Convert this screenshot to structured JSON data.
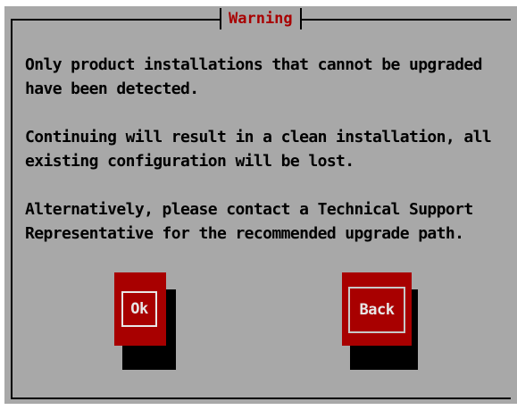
{
  "dialog": {
    "title": "Warning",
    "lines": [
      "Only product installations that cannot be upgraded",
      "have been detected.",
      "Continuing will result in a clean installation, all",
      "existing configuration will be lost.",
      "Alternatively, please contact a Technical Support",
      "Representative for the recommended upgrade path."
    ]
  },
  "buttons": {
    "ok_label": "Ok",
    "back_label": "Back"
  },
  "colors": {
    "panel": "#a8a8a8",
    "accent": "#a80000",
    "button_text": "#e8e8e8"
  }
}
